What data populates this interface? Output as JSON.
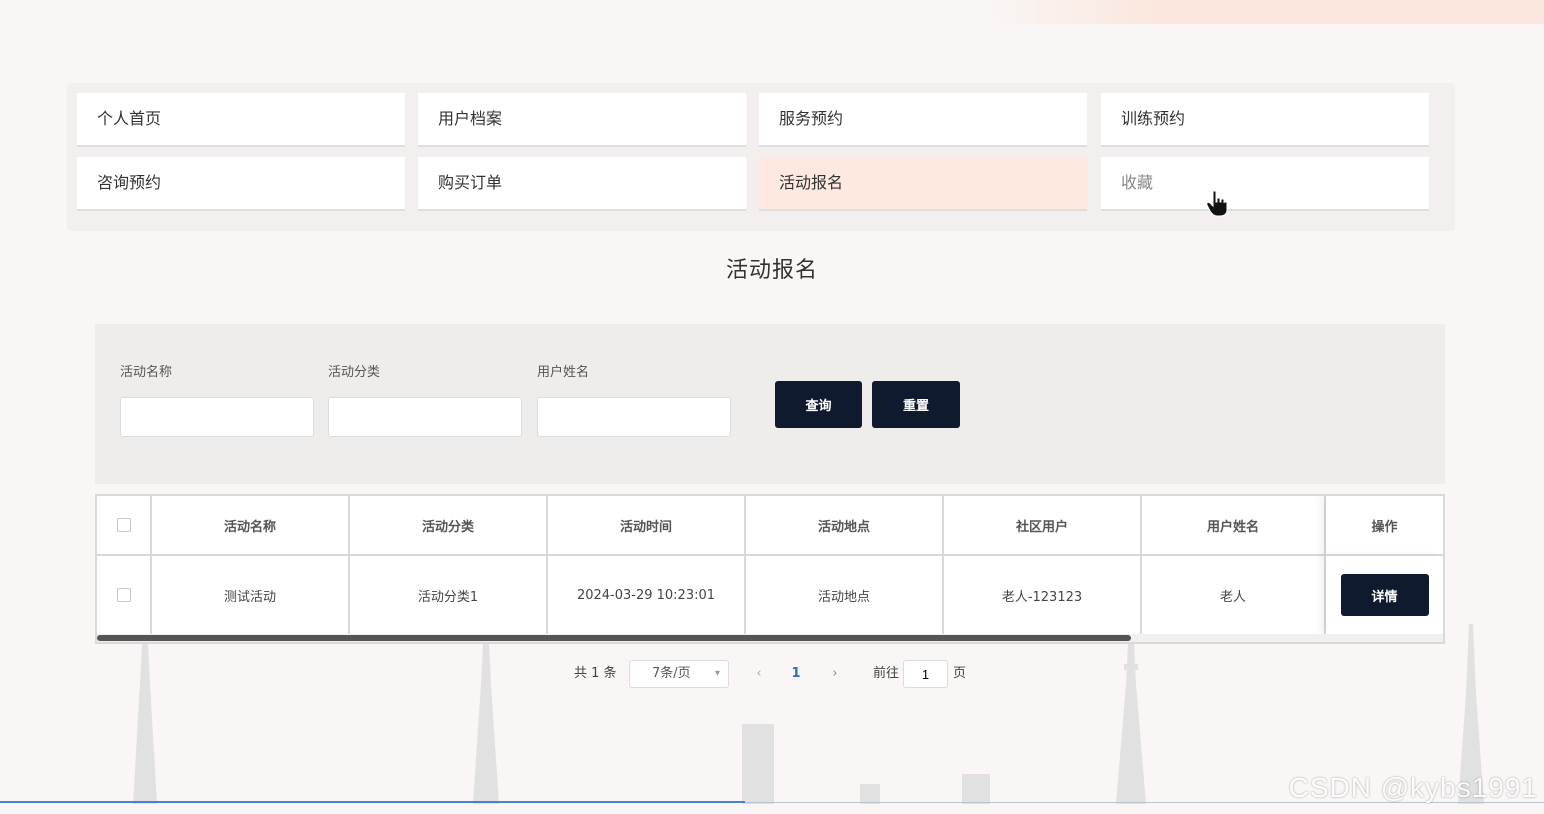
{
  "nav": {
    "items": [
      {
        "label": "个人首页"
      },
      {
        "label": "用户档案"
      },
      {
        "label": "服务预约"
      },
      {
        "label": "训练预约"
      },
      {
        "label": "咨询预约"
      },
      {
        "label": "购买订单"
      },
      {
        "label": "活动报名"
      },
      {
        "label": "收藏"
      }
    ]
  },
  "page_title": "活动报名",
  "search": {
    "fields": [
      {
        "label": "活动名称",
        "value": ""
      },
      {
        "label": "活动分类",
        "value": ""
      },
      {
        "label": "用户姓名",
        "value": ""
      }
    ],
    "query_label": "查询",
    "reset_label": "重置"
  },
  "table": {
    "headers": [
      "活动名称",
      "活动分类",
      "活动时间",
      "活动地点",
      "社区用户",
      "用户姓名",
      "操作"
    ],
    "rows": [
      {
        "cells": [
          "测试活动",
          "活动分类1",
          "2024-03-29 10:23:01",
          "活动地点",
          "老人-123123",
          "老人"
        ],
        "action_label": "详情"
      }
    ]
  },
  "pagination": {
    "total_text": "共 1 条",
    "page_size": "7条/页",
    "prev": "‹",
    "current": "1",
    "next": "›",
    "goto_label": "前往",
    "goto_value": "1",
    "page_unit": "页"
  },
  "watermark": "CSDN @kybs1991",
  "colors": {
    "dark_button": "#0f1a2e",
    "active_nav": "#fde9e0",
    "page_background": "#f9f6f5",
    "current_page": "#2a6dd1"
  }
}
